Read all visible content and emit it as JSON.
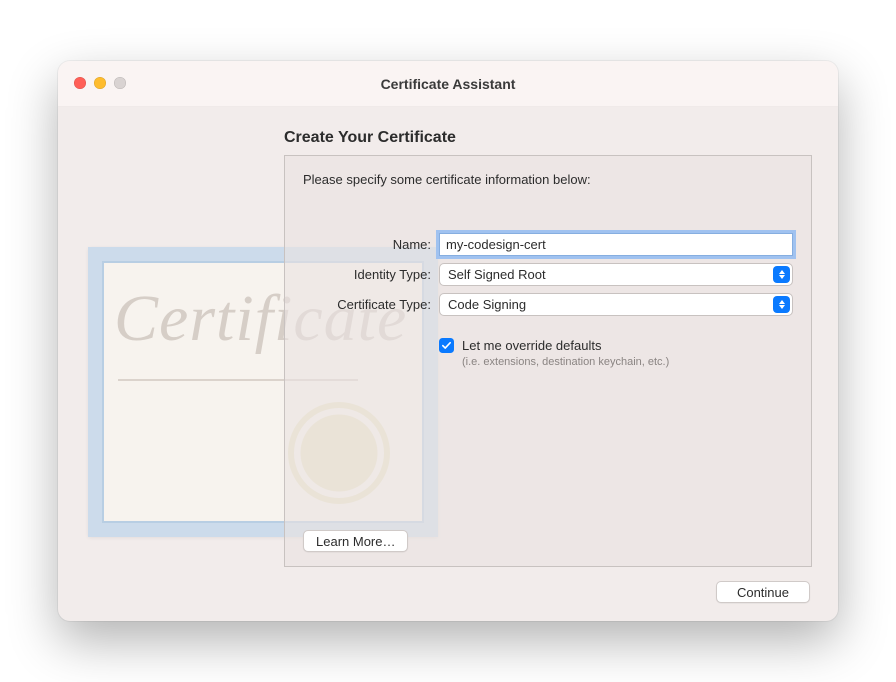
{
  "window": {
    "title": "Certificate Assistant"
  },
  "heading": "Create Your Certificate",
  "instruction": "Please specify some certificate information below:",
  "form": {
    "name_label": "Name:",
    "name_value": "my-codesign-cert",
    "identity_type_label": "Identity Type:",
    "identity_type_value": "Self Signed Root",
    "certificate_type_label": "Certificate Type:",
    "certificate_type_value": "Code Signing",
    "override_checked": true,
    "override_label": "Let me override defaults",
    "override_sub": "(i.e. extensions, destination keychain, etc.)"
  },
  "buttons": {
    "learn_more": "Learn More…",
    "continue": "Continue"
  },
  "bg": {
    "script_text": "Certificate"
  }
}
